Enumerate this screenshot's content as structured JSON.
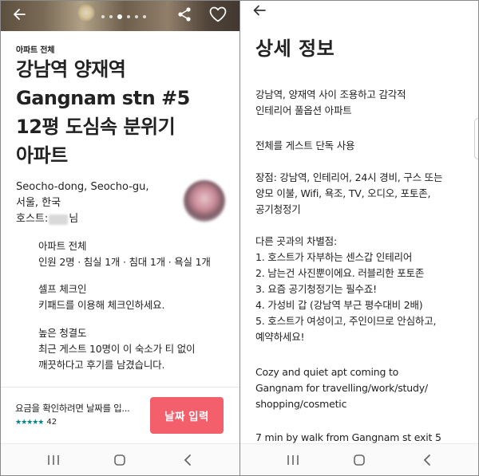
{
  "left": {
    "listing_type": "아파트 전체",
    "title_lines": [
      "강남역 양재역",
      "Gangnam stn #5",
      "12평 도심속 분위기",
      "아파트"
    ],
    "location_lines": [
      "Seocho-dong, Seocho-gu,",
      "서울, 한국"
    ],
    "host": {
      "prefix": "호스트:",
      "suffix": "님"
    },
    "features": [
      {
        "title": "아파트 전체",
        "desc": [
          "인원 2명 · 침실 1개 · 침대 1개 · 욕실 1개"
        ]
      },
      {
        "title": "셀프 체크인",
        "desc": [
          "키패드를 이용해 체크인하세요."
        ]
      },
      {
        "title": "높은 청결도",
        "desc": [
          "최근 게스트 10명이 이 숙소가 티 없이",
          "깨끗하다고 후기를 남겼습니다."
        ]
      }
    ],
    "booking": {
      "price_hint": "요금을 확인하려면 날짜를 입...",
      "stars": "★★★★★",
      "review_count": "42",
      "date_button": "날짜 입력"
    },
    "gallery": {
      "image_count": 6,
      "active_index": 2
    }
  },
  "right": {
    "title": "상세 정보",
    "paragraphs": [
      [
        "강남역, 양재역 사이 조용하고 감각적",
        "인테리어 풀옵션 아파트"
      ],
      [
        "전체를 게스트 단독 사용"
      ],
      [
        "장점: 강남역, 인테리어, 24시 경비, 구스 또는",
        "양모 이불, Wifi, 욕조, TV, 오디오, 포토존,",
        "공기청정기"
      ],
      [
        "다른 곳과의 차별점:",
        "1. 호스트가 자부하는 센스갑 인테리어",
        "2. 남는건 사진뿐이에요. 러블리한 포토존",
        "3. 요즘 공기청정기는 필수죠!",
        "4. 가성비 갑 (강남역 부근 평수대비 2배)",
        "5. 호스트가 여성이고, 주인이므로 안심하고,",
        "예약하세요!"
      ],
      [
        "Cozy and quiet apt coming to",
        "Gangnam for travelling/work/study/",
        "shopping/cosmetic"
      ],
      [
        "7 min by walk from Gangnam st exit 5"
      ]
    ]
  },
  "icons": {
    "back": "back-arrow-icon",
    "share": "share-icon",
    "heart": "heart-icon",
    "recents": "recent-apps-icon",
    "home": "home-icon",
    "nav_back": "nav-back-icon"
  },
  "colors": {
    "accent": "#f3606c",
    "stars": "#008489"
  }
}
